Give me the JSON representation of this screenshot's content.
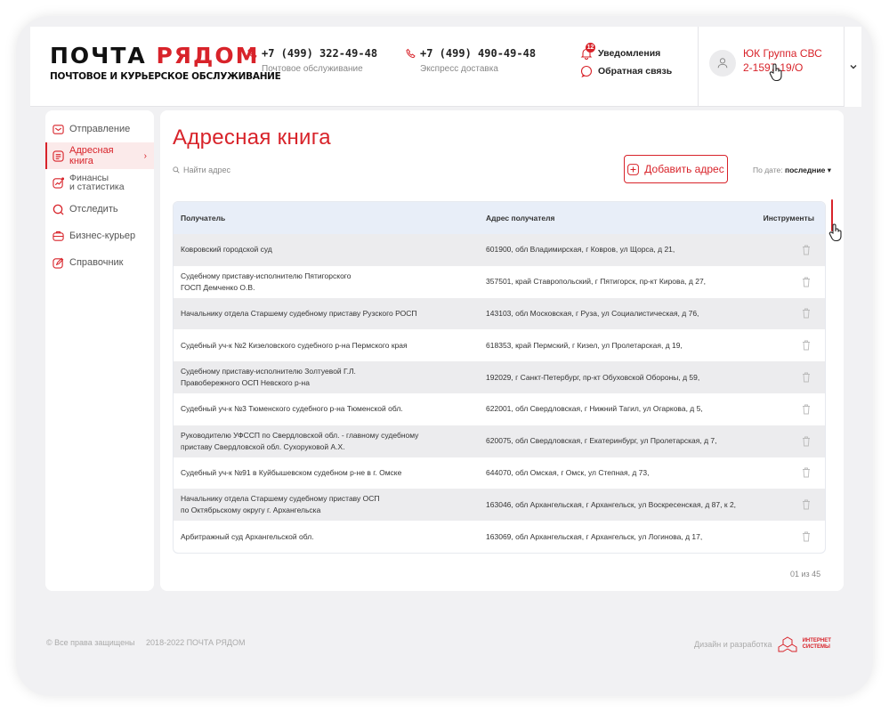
{
  "header": {
    "logo_part1": "ПОЧТА ",
    "logo_part2": "РЯДОМ",
    "logo_sub": "ПОЧТОВОЕ И КУРЬЕРСКОЕ ОБСЛУЖИВАНИЕ",
    "phone1": "+7 (499) 322-49-48",
    "phone1_label": "Почтовое обслуживание",
    "phone2": "+7 (499) 490-49-48",
    "phone2_label": "Экспресс доставка",
    "notifications_label": "Уведомления",
    "notifications_count": "12",
    "feedback_label": "Обратная связь",
    "user_line1": "ЮК Группа СВС",
    "user_line2": "2-1597-19/О"
  },
  "sidebar": {
    "items": [
      {
        "label": "Отправление",
        "icon": "envelope-icon"
      },
      {
        "label": "Адресная книга",
        "icon": "address-book-icon",
        "active": true,
        "arrow": "›"
      },
      {
        "label1": "Финансы",
        "label2": "и статистика",
        "icon": "chart-icon"
      },
      {
        "label": "Отследить",
        "icon": "track-search-icon"
      },
      {
        "label": "Бизнес-курьер",
        "icon": "courier-box-icon"
      },
      {
        "label": "Справочник",
        "icon": "edit-icon"
      }
    ]
  },
  "main": {
    "title": "Адресная книга",
    "search_placeholder": "Найти адрес",
    "add_button": "Добавить адрес",
    "sort_label": "По дате: ",
    "sort_value": "последние ▾",
    "pager": "01 из 45"
  },
  "table": {
    "headers": [
      "Получатель",
      "Адрес получателя",
      "Инструменты"
    ],
    "rows": [
      {
        "recipient": "Ковровский городской суд",
        "recipient2": "",
        "address": "601900, обл Владимирская, г Ковров, ул Щорса, д 21,"
      },
      {
        "recipient": "Судебному приставу-исполнителю Пятигорского",
        "recipient2": "ГОСП Демченко О.В.",
        "address": "357501, край Ставропольский, г Пятигорск, пр-кт Кирова, д 27,"
      },
      {
        "recipient": "Начальнику отдела Старшему судебному приставу Рузского РОСП",
        "recipient2": "",
        "address": "143103, обл Московская, г Руза, ул Социалистическая, д 76,"
      },
      {
        "recipient": "Судебный уч-к №2 Кизеловского судебного р-на Пермского края",
        "recipient2": "",
        "address": "618353, край Пермский, г Кизел, ул Пролетарская, д 19,"
      },
      {
        "recipient": "Судебному приставу-исполнителю Золтуевой Г.Л.",
        "recipient2": "Правобережного ОСП Невского р-на",
        "address": "192029, г Санкт-Петербург, пр-кт Обуховской Обороны, д 59,"
      },
      {
        "recipient": "Судебный уч-к №3 Тюменского судебного р-на Тюменской обл.",
        "recipient2": "",
        "address": "622001, обл Свердловская, г Нижний Тагил, ул Огаркова, д 5,"
      },
      {
        "recipient": "Руководителю УФССП по Свердловской обл. - главному судебному",
        "recipient2": "приставу Свердловской обл. Сухоруковой А.Х.",
        "address": "620075, обл Свердловская, г Екатеринбург, ул Пролетарская, д 7,"
      },
      {
        "recipient": "Судебный уч-к №91 в Куйбышевском судебном р-не в г. Омске",
        "recipient2": "",
        "address": "644070, обл Омская, г Омск, ул Степная, д 73,"
      },
      {
        "recipient": "Начальнику отдела Старшему судебному приставу ОСП",
        "recipient2": "по Октябрьскому округу г. Архангельска",
        "address": "163046, обл Архангельская, г Архангельск, ул Воскресенская, д 87, к 2,"
      },
      {
        "recipient": "Арбитражный суд Архангельской обл.",
        "recipient2": "",
        "address": "163069, обл Архангельская, г Архангельск, ул Логинова, д 17,"
      }
    ]
  },
  "footer": {
    "copyright": "© Все права защищены",
    "years": "2018-2022 ПОЧТА РЯДОМ",
    "design_label": "Дизайн и разработка",
    "brand_line1": "ИНТЕРНЕТ",
    "brand_line2": "СИСТЕМЫ"
  },
  "colors": {
    "accent": "#d8232a",
    "table_header": "#e8eef8",
    "row_stripe": "#ececee"
  }
}
